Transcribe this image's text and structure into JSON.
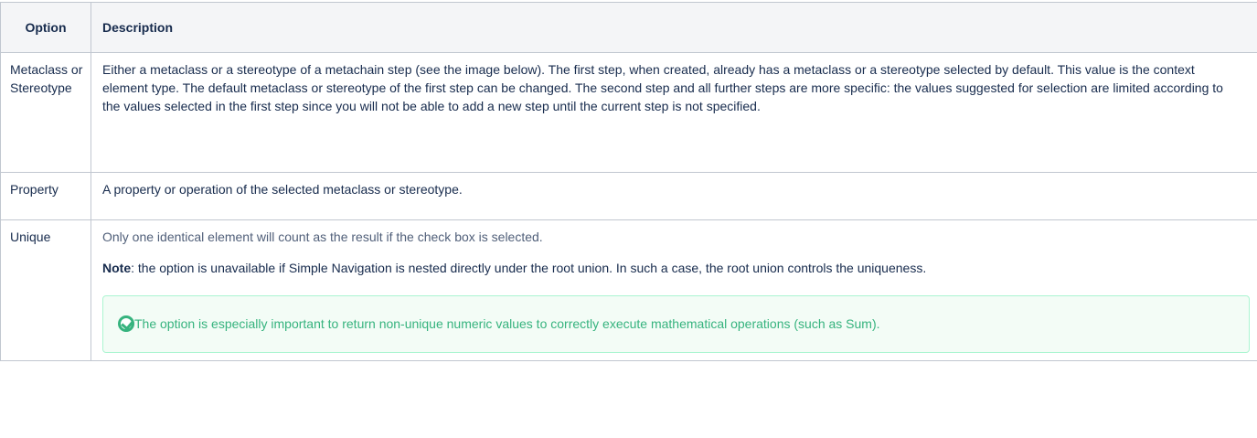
{
  "table": {
    "headers": {
      "option": "Option",
      "description": "Description"
    },
    "rows": [
      {
        "option": "Metaclass or Stereotype",
        "description": "Either a metaclass or a stereotype of a metachain step (see the image below). The first step, when created, already has a metaclass or a stereotype selected by default. This value is the context element type. The default metaclass or stereotype of the first step can be changed. The second step and all further steps are more specific: the values suggested for selection are limited according to the values selected in the first step since you will not be able to add a new step until the current step is not specified."
      },
      {
        "option": "Property",
        "description": "A property or operation of the selected metaclass or stereotype."
      },
      {
        "option": "Unique",
        "description": "Only one identical element will count as the result if the check box is selected.",
        "note_label": "Note",
        "note_text": ": the option is unavailable if Simple Navigation is nested directly under the root union. In such a case, the root union controls the uniqueness.",
        "callout": {
          "icon": "check-circle-icon",
          "text": "The option is especially important to return non-unique numeric values to correctly execute mathematical operations (such as Sum).",
          "color": "#36b37e",
          "background": "#f3fcf6",
          "border": "#abf5d1"
        }
      }
    ]
  }
}
